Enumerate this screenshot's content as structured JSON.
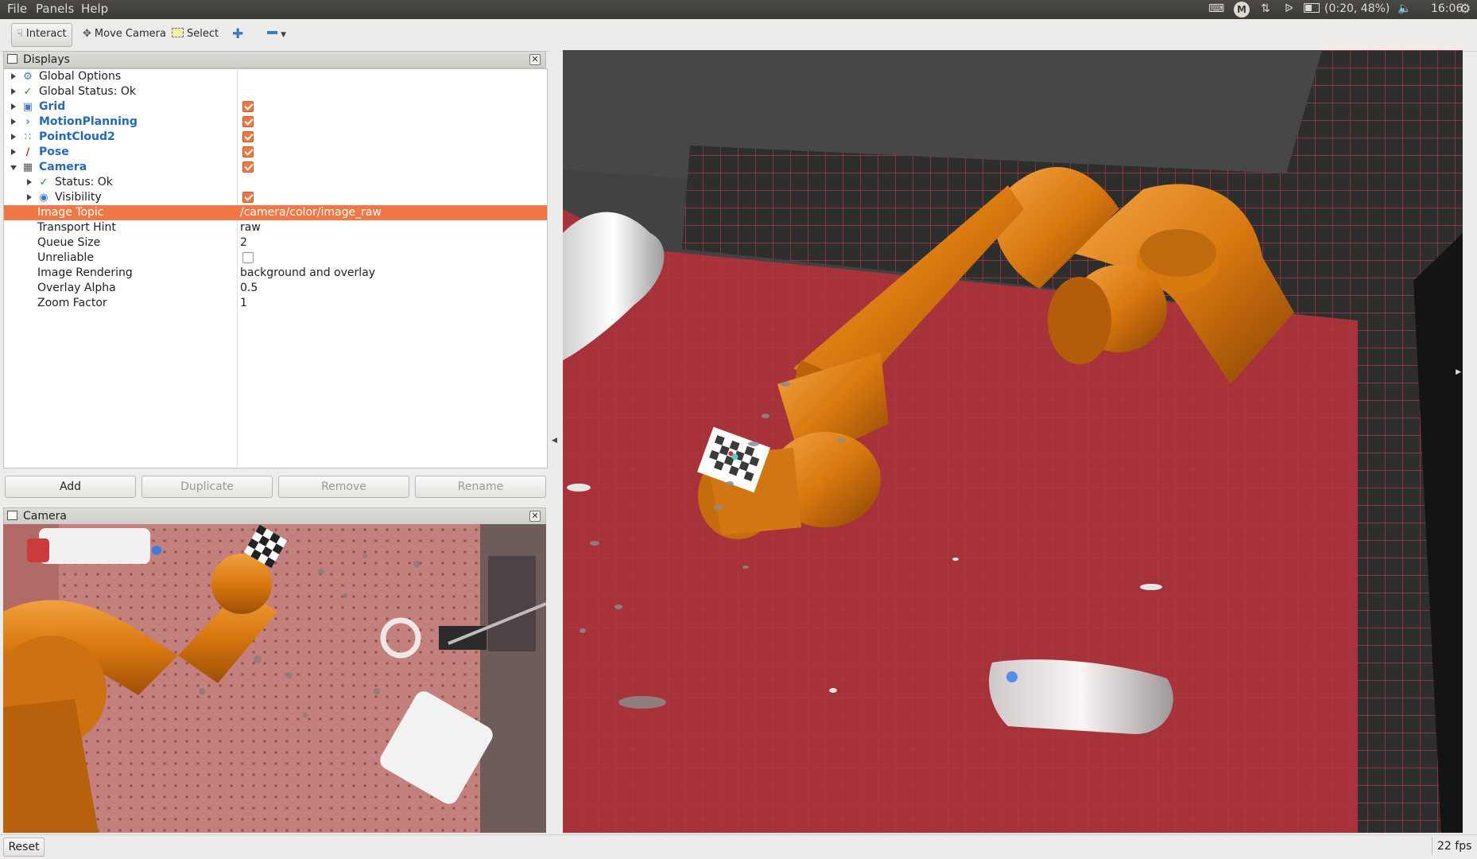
{
  "topbar": {
    "menus": [
      "File",
      "Panels",
      "Help"
    ],
    "tray": {
      "m_icon": "M",
      "battery": "(0:20, 48%)",
      "clock": "16:06"
    }
  },
  "toolbar": {
    "interact": "Interact",
    "move_camera": "Move Camera",
    "select": "Select"
  },
  "displays_panel": {
    "title": "Displays",
    "rows": [
      {
        "label": "Global Options",
        "icon": "gear-icon"
      },
      {
        "label": "Global Status: Ok",
        "icon": "check-icon"
      },
      {
        "label": "Grid",
        "icon": "grid-icon",
        "checked": true
      },
      {
        "label": "MotionPlanning",
        "icon": "motion-planning-icon",
        "checked": true
      },
      {
        "label": "PointCloud2",
        "icon": "pointcloud-icon",
        "checked": true
      },
      {
        "label": "Pose",
        "icon": "pose-arrow-icon",
        "checked": true
      },
      {
        "label": "Camera",
        "icon": "camera-icon",
        "checked": true
      },
      {
        "label": "Status: Ok",
        "icon": "check-icon"
      },
      {
        "label": "Visibility",
        "icon": "eye-icon",
        "checked": true
      },
      {
        "label": "Image Topic",
        "value": "/camera/color/image_raw"
      },
      {
        "label": "Transport Hint",
        "value": "raw"
      },
      {
        "label": "Queue Size",
        "value": "2"
      },
      {
        "label": "Unreliable",
        "checked": false
      },
      {
        "label": "Image Rendering",
        "value": "background and overlay"
      },
      {
        "label": "Overlay Alpha",
        "value": "0.5"
      },
      {
        "label": "Zoom Factor",
        "value": "1"
      }
    ],
    "buttons": {
      "add": "Add",
      "duplicate": "Duplicate",
      "remove": "Remove",
      "rename": "Rename"
    }
  },
  "camera_panel": {
    "title": "Camera"
  },
  "statusbar": {
    "reset": "Reset",
    "fps": "22 fps"
  },
  "colors": {
    "selection": "#f07746",
    "link_blue": "#2769b3",
    "floor_red": "#a8323a",
    "robot_orange": "#d9780f"
  }
}
